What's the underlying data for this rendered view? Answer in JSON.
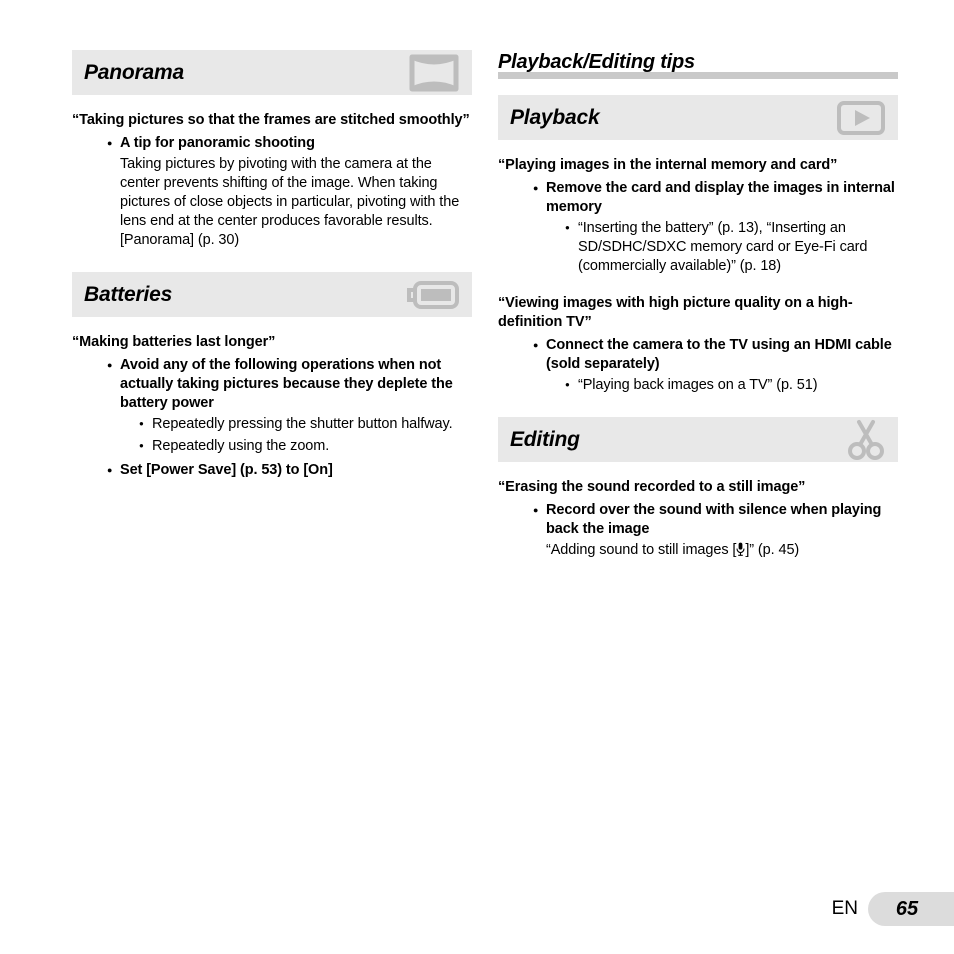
{
  "footer": {
    "language": "EN",
    "page_number": "65"
  },
  "left_column": {
    "sections": [
      {
        "band_title": "Panorama",
        "icon": "panorama-icon",
        "quote": "“Taking pictures so that the frames are stitched smoothly”",
        "bullet1": "A tip for panoramic shooting",
        "paragraph": "Taking pictures by pivoting with the camera at the center prevents shifting of the image. When taking pictures of close objects in particular, pivoting with the lens end at the center produces favorable results.",
        "reference": "[Panorama] (p. 30)"
      },
      {
        "band_title": "Batteries",
        "icon": "battery-icon",
        "quote": "“Making batteries last longer”",
        "bullet1": "Avoid any of the following operations when not actually taking pictures because they deplete the battery power",
        "sub_bullets": [
          "Repeatedly pressing the shutter button halfway.",
          "Repeatedly using the zoom."
        ],
        "bullet1_b": "Set [Power Save] (p. 53) to [On]"
      }
    ]
  },
  "right_column": {
    "tips_title": "Playback/Editing tips",
    "sections": [
      {
        "band_title": "Playback",
        "icon": "play-icon",
        "quote_a": "“Playing images in the internal memory and card”",
        "bullet_a": "Remove the card and display the images in internal memory",
        "sub_a": "“Inserting the battery” (p. 13), “Inserting an SD/SDHC/SDXC memory card or Eye-Fi card (commercially available)” (p. 18)",
        "quote_b": "“Viewing images with high picture quality on a high-definition TV”",
        "bullet_b": "Connect the camera to the TV using an HDMI cable (sold separately)",
        "sub_b": "“Playing back images on a TV” (p. 51)"
      },
      {
        "band_title": "Editing",
        "icon": "scissors-icon",
        "quote": "“Erasing the sound recorded to a still image”",
        "bullet1": "Record over the sound with silence when playing back the image",
        "reference_prefix": "“Adding sound to still images [",
        "reference_suffix": "]” (p. 45)"
      }
    ]
  },
  "colors": {
    "band_background": "#e8e8e8",
    "rule_bar": "#c9c9c9",
    "icon_gray": "#bdbdbd",
    "page_box": "#dcdcdc"
  }
}
